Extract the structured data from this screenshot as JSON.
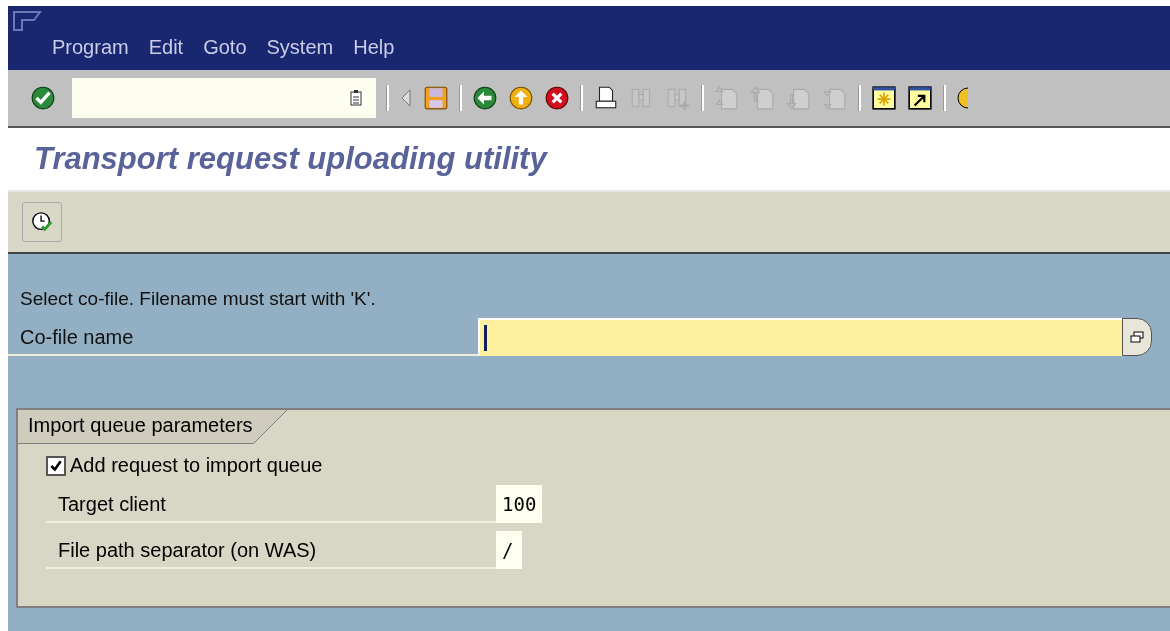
{
  "menu_bar": {
    "items": [
      "Program",
      "Edit",
      "Goto",
      "System",
      "Help"
    ]
  },
  "toolbar": {
    "buttons": [
      {
        "kind": "enter",
        "disabled": false
      },
      {
        "kind": "sep"
      },
      {
        "kind": "back-small",
        "disabled": false
      },
      {
        "kind": "save",
        "disabled": false
      },
      {
        "kind": "sep"
      },
      {
        "kind": "back",
        "disabled": false
      },
      {
        "kind": "exit",
        "disabled": false
      },
      {
        "kind": "cancel",
        "disabled": false
      },
      {
        "kind": "sep"
      },
      {
        "kind": "print",
        "disabled": false
      },
      {
        "kind": "find",
        "disabled": true
      },
      {
        "kind": "find-next",
        "disabled": true
      },
      {
        "kind": "sep"
      },
      {
        "kind": "first-page",
        "disabled": true
      },
      {
        "kind": "prev-page",
        "disabled": true
      },
      {
        "kind": "next-page",
        "disabled": true
      },
      {
        "kind": "last-page",
        "disabled": true
      },
      {
        "kind": "sep"
      },
      {
        "kind": "new-session",
        "disabled": false
      },
      {
        "kind": "shortcut",
        "disabled": false
      },
      {
        "kind": "sep"
      },
      {
        "kind": "help",
        "disabled": false
      }
    ]
  },
  "title": "Transport request uploading utility",
  "app_toolbar": {
    "buttons": [
      {
        "kind": "execute"
      }
    ]
  },
  "instruction": "Select co-file. Filename must start with 'K'.",
  "cofile": {
    "label": "Co-file name"
  },
  "group": {
    "title": "Import queue parameters",
    "checkbox": {
      "label": "Add request to import queue",
      "checked": true
    },
    "fields": [
      {
        "label": "Target client",
        "value": "100"
      },
      {
        "label": "File path separator (on WAS)",
        "value": "/"
      }
    ]
  }
}
